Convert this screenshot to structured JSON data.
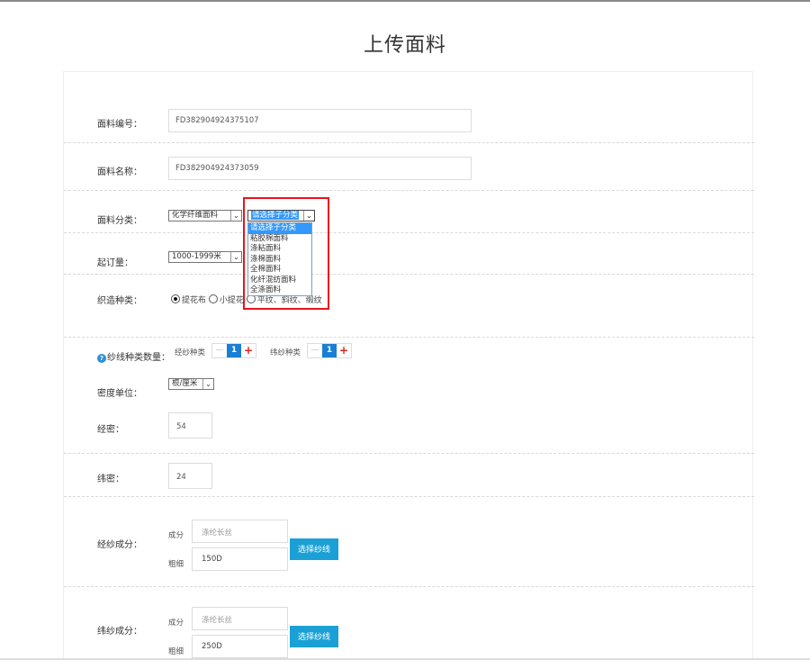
{
  "page": {
    "title": "上传面料"
  },
  "fields": {
    "fabric_no": {
      "label": "面料编号：",
      "value": "FD382904924375107"
    },
    "fabric_name": {
      "label": "面料名称：",
      "value": "FD382904924373059"
    },
    "category": {
      "label": "面料分类：",
      "main_selected": "化学纤维面料",
      "sub_selected": "请选择子分类",
      "sub_options": [
        "请选择子分类",
        "粘胶棉面料",
        "涤粘面料",
        "涤棉面料",
        "全棉面料",
        "化纤混纺面料",
        "全涤面料"
      ]
    },
    "moq": {
      "label": "起订量：",
      "selected": "1000-1999米"
    },
    "weave": {
      "label": "织造种类：",
      "options": [
        "提花布",
        "小提花",
        "平纹、斜纹、缎纹"
      ],
      "selected_index": 0
    },
    "yarn_count": {
      "label": "纱线种类数量：",
      "warp_label": "经纱种类",
      "warp_value": "1",
      "weft_label": "纬纱种类",
      "weft_value": "1",
      "minus": "—",
      "plus": "+",
      "help_icon": "?"
    },
    "density_unit": {
      "label": "密度单位：",
      "selected": "根/厘米"
    },
    "warp_density": {
      "label": "经密：",
      "value": "54"
    },
    "weft_density": {
      "label": "纬密：",
      "value": "24"
    },
    "warp_composition": {
      "label": "经纱成分：",
      "comp_label": "成分",
      "comp_placeholder": "涤纶长丝",
      "thick_label": "粗细",
      "thick_value": "150D",
      "button": "选择纱线"
    },
    "weft_composition": {
      "label": "纬纱成分：",
      "comp_label": "成分",
      "comp_placeholder": "涤纶长丝",
      "thick_label": "粗细",
      "thick_value": "250D",
      "button": "选择纱线"
    }
  },
  "colors": {
    "accent_blue": "#1ba0d6",
    "stepper_blue": "#1a7fd4",
    "highlight_red": "#e8141c"
  }
}
